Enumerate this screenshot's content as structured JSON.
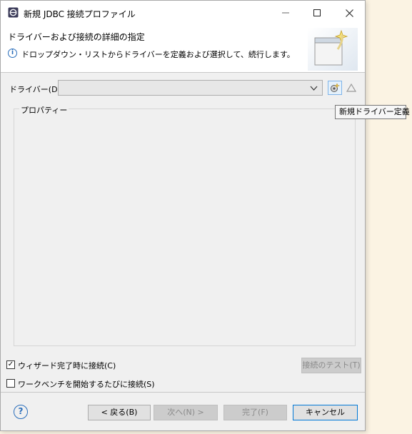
{
  "window": {
    "title": "新規 JDBC 接続プロファイル",
    "minimize_icon": "minimize-icon",
    "maximize_icon": "maximize-icon",
    "close_icon": "close-icon"
  },
  "header": {
    "title": "ドライバーおよび接続の詳細の指定",
    "info_icon": "info-icon",
    "info_glyph": "i",
    "description": "ドロップダウン・リストからドライバーを定義および選択して、続行します。"
  },
  "driver": {
    "label": "ドライバー(D):",
    "value": "",
    "new_driver_tooltip": "新規ドライバー定義",
    "new_driver_icon": "new-driver-icon",
    "edit_driver_icon": "edit-driver-icon"
  },
  "properties": {
    "label": "プロパティー"
  },
  "options": {
    "connect_on_finish_label": "ウィザード完了時に接続(C)",
    "connect_on_finish_checked": true,
    "check_glyph": "✓",
    "connect_on_startup_label": "ワークベンチを開始するたびに接続(S)",
    "connect_on_startup_checked": false
  },
  "buttons": {
    "test_connection": "接続のテスト(T)",
    "back": "< 戻る(B)",
    "next": "次へ(N) >",
    "finish": "完了(F)",
    "cancel": "キャンセル",
    "help_glyph": "?"
  },
  "colors": {
    "accent": "#0078d7",
    "info_blue": "#2a6ebb",
    "dialog_bg": "#f0f0f0",
    "header_bg": "#ffffff"
  }
}
